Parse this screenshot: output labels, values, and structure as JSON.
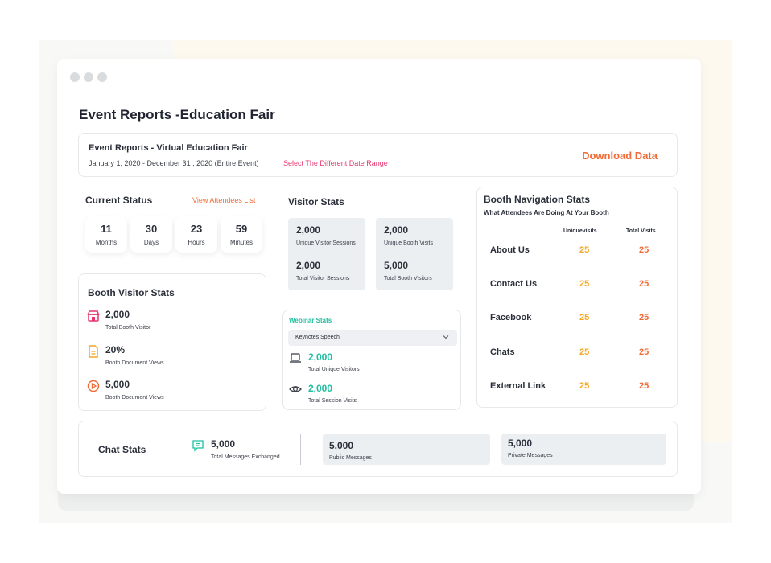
{
  "page_title": "Event Reports -Education Fair",
  "header": {
    "title": "Event Reports - Virtual Education Fair",
    "date_range": "January 1, 2020 - December 31 , 2020 (Entire Event)",
    "select_range_link": "Select The Different Date Range",
    "download_button": "Download Data"
  },
  "current_status": {
    "title": "Current Status",
    "view_attendees_link": "View Attendees List",
    "countdown": [
      {
        "value": "11",
        "label": "Months"
      },
      {
        "value": "30",
        "label": "Days"
      },
      {
        "value": "23",
        "label": "Hours"
      },
      {
        "value": "59",
        "label": "Minutes"
      }
    ]
  },
  "booth_visitor_stats": {
    "title": "Booth Visitor Stats",
    "items": [
      {
        "value": "2,000",
        "label": "Total Booth Visitor",
        "icon": "store-icon",
        "color": "#e8356d"
      },
      {
        "value": "20%",
        "label": "Booth Document Views",
        "icon": "document-icon",
        "color": "#f5a623"
      },
      {
        "value": "5,000",
        "label": "Booth Document Views",
        "icon": "play-circle-icon",
        "color": "#f26b36"
      }
    ]
  },
  "visitor_stats": {
    "title": "Visitor Stats",
    "cells": [
      {
        "value": "2,000",
        "label": "Unique Visitor Sessions"
      },
      {
        "value": "2,000",
        "label": "Total Visitor Sessions"
      },
      {
        "value": "2,000",
        "label": "Unique Booth Visits"
      },
      {
        "value": "5,000",
        "label": "Total Booth Visitors"
      }
    ]
  },
  "webinar_stats": {
    "title": "Webinar Stats",
    "selected_option": "Keynotes Speech",
    "items": [
      {
        "value": "2,000",
        "label": "Total Unique Visitors",
        "icon": "laptop-icon"
      },
      {
        "value": "2,000",
        "label": "Total Session Visits",
        "icon": "eye-icon"
      }
    ]
  },
  "booth_navigation": {
    "title": "Booth Navigation Stats",
    "subtitle": "What Attendees Are Doing At Your Booth",
    "col_unique": "Uniquevisits",
    "col_total": "Total Visits",
    "rows": [
      {
        "label": "About Us",
        "unique": "25",
        "total": "25"
      },
      {
        "label": "Contact Us",
        "unique": "25",
        "total": "25"
      },
      {
        "label": "Facebook",
        "unique": "25",
        "total": "25"
      },
      {
        "label": "Chats",
        "unique": "25",
        "total": "25"
      },
      {
        "label": "External Link",
        "unique": "25",
        "total": "25"
      }
    ]
  },
  "chat_stats": {
    "title": "Chat Stats",
    "total": {
      "value": "5,000",
      "label": "Total Messages Exchanged",
      "icon": "chat-icon"
    },
    "public": {
      "value": "5,000",
      "label": "Public Messages"
    },
    "private": {
      "value": "5,000",
      "label": "Private Messages"
    }
  },
  "colors": {
    "accent_orange": "#f26b36",
    "accent_pink": "#e8356d",
    "accent_yellow": "#f5a623",
    "accent_teal": "#1fbf9f"
  }
}
